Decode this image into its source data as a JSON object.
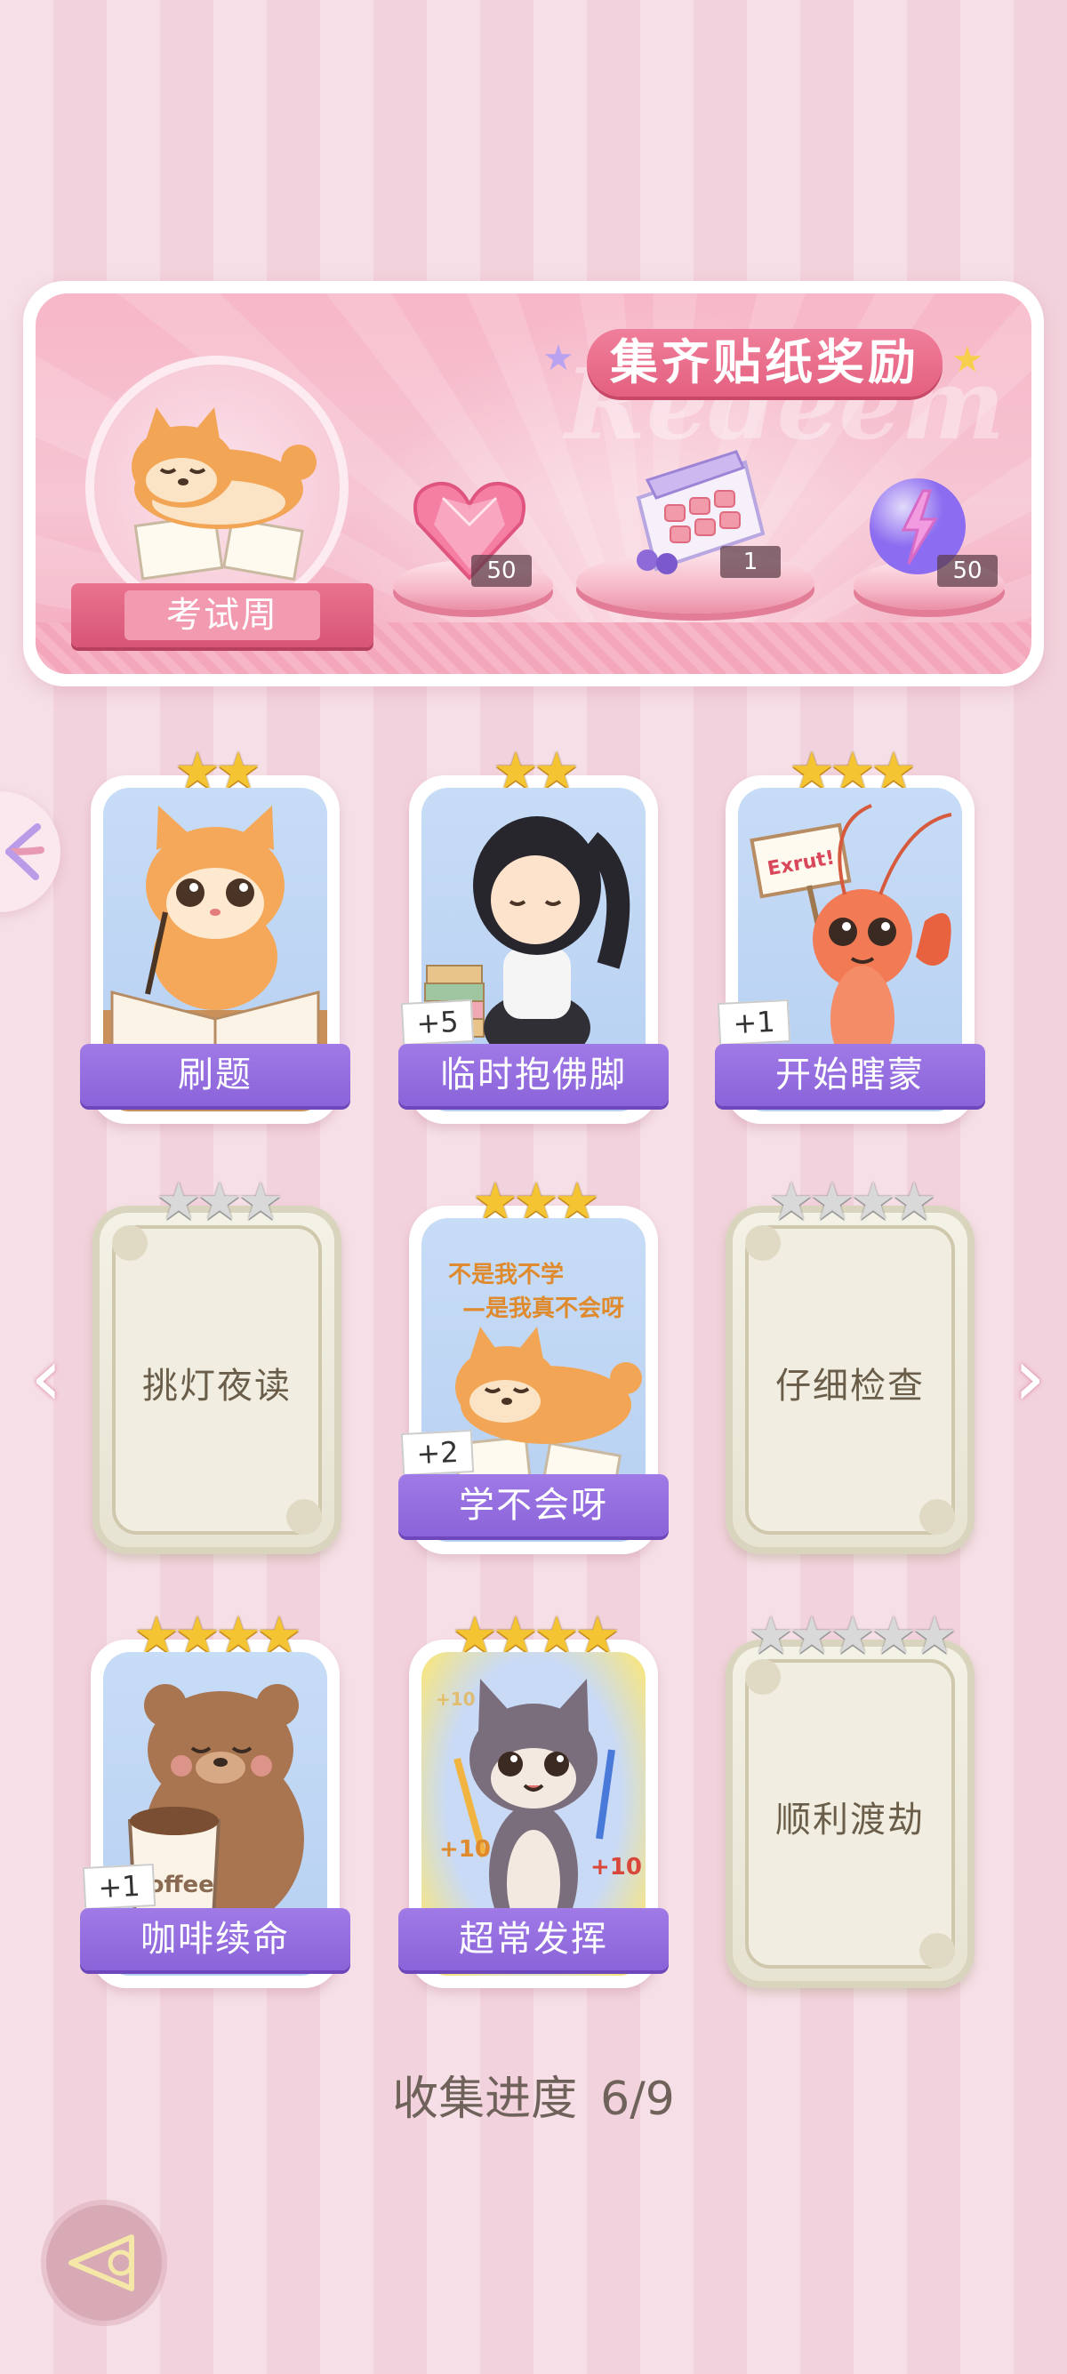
{
  "banner": {
    "title": "集齐贴纸奖励",
    "watermark": "Redeem",
    "theme_label": "考试周",
    "rewards": [
      {
        "name": "heart-gem",
        "count": "50"
      },
      {
        "name": "gift-box",
        "count": "1"
      },
      {
        "name": "energy-orb",
        "count": "50"
      }
    ]
  },
  "cards": [
    {
      "label": "刷题",
      "stars": "★★",
      "bonus": "",
      "locked": false
    },
    {
      "label": "临时抱佛脚",
      "stars": "★★",
      "bonus": "+5",
      "locked": false
    },
    {
      "label": "开始瞎蒙",
      "stars": "★★★",
      "bonus": "+1",
      "locked": false
    },
    {
      "label": "挑灯夜读",
      "stars": "★★★",
      "bonus": "",
      "locked": true
    },
    {
      "label": "学不会呀",
      "stars": "★★★",
      "bonus": "+2",
      "locked": false
    },
    {
      "label": "仔细检查",
      "stars": "★★★★",
      "bonus": "",
      "locked": true
    },
    {
      "label": "咖啡续命",
      "stars": "★★★★",
      "bonus": "+1",
      "locked": false
    },
    {
      "label": "超常发挥",
      "stars": "★★★★",
      "bonus": "",
      "locked": false
    },
    {
      "label": "顺利渡劫",
      "stars": "★★★★★",
      "bonus": "",
      "locked": true
    }
  ],
  "art_text": {
    "lobster_sign": "Exrut!",
    "shiba_caption_1": "不是我不学",
    "shiba_caption_2": "—是我真不会呀",
    "coffee_word": "coffee",
    "plus_ten": "+10"
  },
  "progress": {
    "label": "收集进度",
    "value": "6/9"
  },
  "colors": {
    "accent_purple": "#8a63d9",
    "accent_pink": "#e4607f",
    "star_gold": "#f5c433"
  }
}
